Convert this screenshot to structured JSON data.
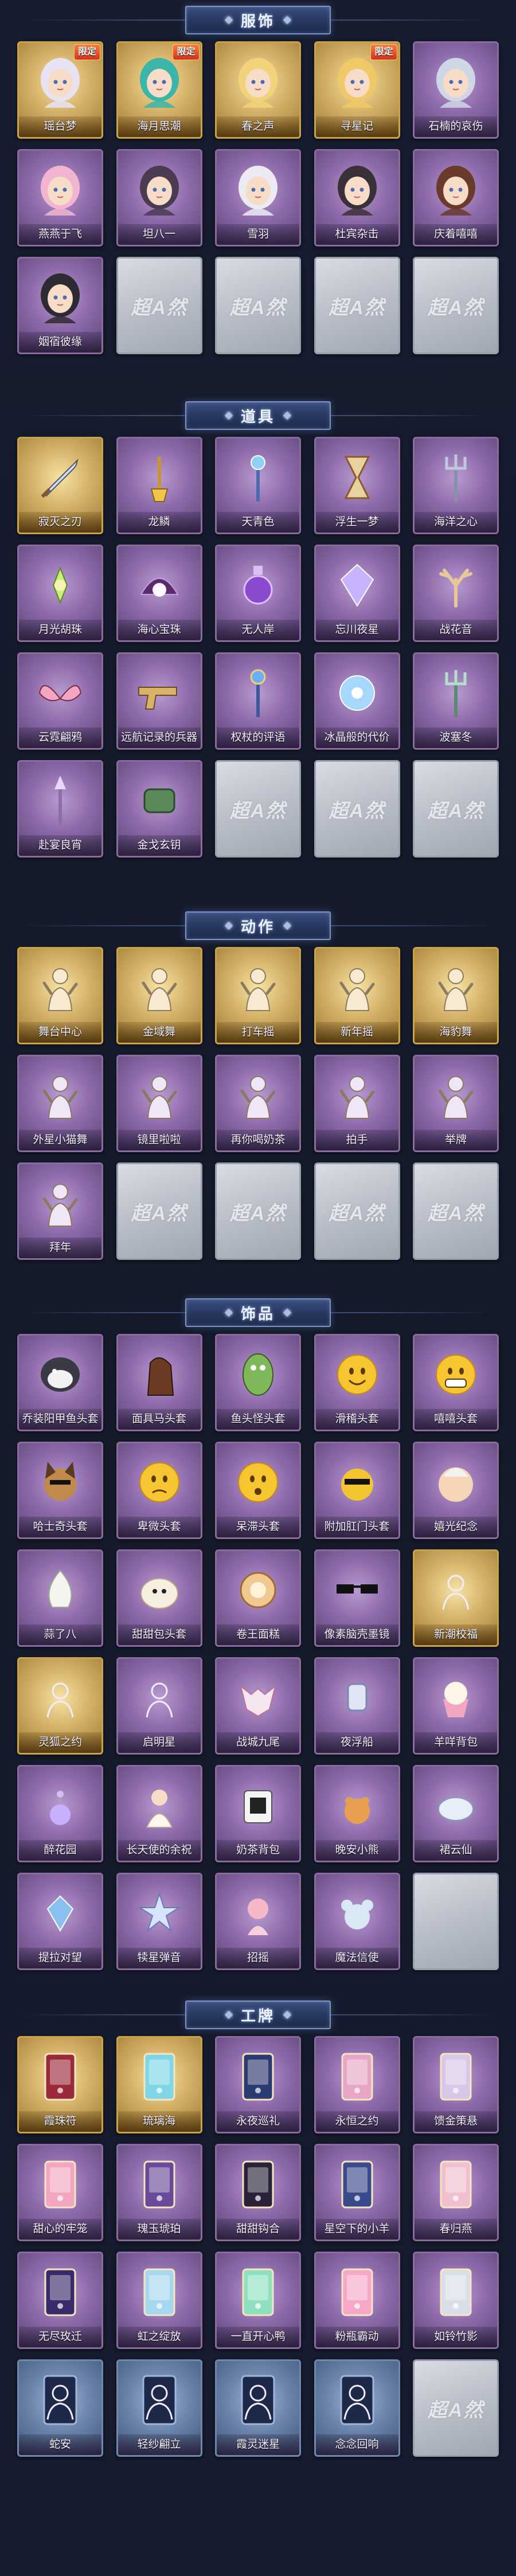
{
  "sections": [
    {
      "title": "服饰",
      "items": [
        {
          "label": "瑶台梦",
          "frame": "gold",
          "badge": "限定",
          "badge_style": "normal",
          "icon": "portrait-white-hair"
        },
        {
          "label": "海月思潮",
          "frame": "gold",
          "badge": "限定",
          "badge_style": "normal",
          "icon": "portrait-teal-hair"
        },
        {
          "label": "春之声",
          "frame": "gold",
          "badge": "",
          "badge_style": "",
          "icon": "portrait-golden"
        },
        {
          "label": "寻星记",
          "frame": "gold",
          "badge": "限定",
          "badge_style": "normal",
          "icon": "portrait-blonde"
        },
        {
          "label": "石楠的哀伤",
          "frame": "purple",
          "badge": "",
          "badge_style": "",
          "icon": "portrait-silver"
        },
        {
          "label": "燕燕于飞",
          "frame": "purple",
          "badge": "",
          "badge_style": "",
          "icon": "portrait-pink-hair"
        },
        {
          "label": "坦八一",
          "frame": "purple",
          "badge": "",
          "badge_style": "",
          "icon": "portrait-dark-hair"
        },
        {
          "label": "雪羽",
          "frame": "purple",
          "badge": "",
          "badge_style": "",
          "icon": "portrait-white-knight"
        },
        {
          "label": "杜宾杂击",
          "frame": "purple",
          "badge": "",
          "badge_style": "",
          "icon": "portrait-cat-ears"
        },
        {
          "label": "庆着嘻嘻",
          "frame": "purple",
          "badge": "",
          "badge_style": "",
          "icon": "portrait-chef"
        },
        {
          "label": "姻宿彼缘",
          "frame": "purple",
          "badge": "",
          "badge_style": "",
          "icon": "portrait-robe"
        },
        {
          "label": "",
          "frame": "gray",
          "badge": "",
          "badge_style": "",
          "icon": "",
          "watermark": "超A然"
        },
        {
          "label": "",
          "frame": "gray",
          "badge": "",
          "badge_style": "",
          "icon": "",
          "watermark": "超A然"
        },
        {
          "label": "",
          "frame": "gray",
          "badge": "",
          "badge_style": "",
          "icon": "",
          "watermark": "超A然"
        },
        {
          "label": "",
          "frame": "gray",
          "badge": "",
          "badge_style": "",
          "icon": "",
          "watermark": "超A然"
        }
      ]
    },
    {
      "title": "道具",
      "items": [
        {
          "label": "寂灭之刃",
          "frame": "gold",
          "icon": "sword-icon"
        },
        {
          "label": "龙鳞",
          "frame": "purple",
          "icon": "golden-shovel-icon"
        },
        {
          "label": "天青色",
          "frame": "purple",
          "icon": "blue-staff-icon"
        },
        {
          "label": "浮生一梦",
          "frame": "purple",
          "icon": "hourglass-icon"
        },
        {
          "label": "海洋之心",
          "frame": "purple",
          "icon": "trident-icon"
        },
        {
          "label": "月光胡珠",
          "frame": "purple",
          "icon": "green-lotus-icon"
        },
        {
          "label": "海心宝珠",
          "frame": "purple",
          "icon": "pearl-shell-icon"
        },
        {
          "label": "无人岸",
          "frame": "purple",
          "icon": "potion-icon"
        },
        {
          "label": "忘川夜星",
          "frame": "purple",
          "icon": "crystal-icon"
        },
        {
          "label": "战花音",
          "frame": "purple",
          "icon": "antler-icon"
        },
        {
          "label": "云霓翩鸦",
          "frame": "purple",
          "icon": "fan-wings-icon"
        },
        {
          "label": "远航记录的兵器",
          "frame": "purple",
          "icon": "pistol-icon"
        },
        {
          "label": "权杖的评语",
          "frame": "purple",
          "icon": "scepter-icon"
        },
        {
          "label": "冰晶般的代价",
          "frame": "purple",
          "icon": "ice-flower-icon"
        },
        {
          "label": "波塞冬",
          "frame": "purple",
          "icon": "trident-green-icon"
        },
        {
          "label": "赴宴良宵",
          "frame": "purple",
          "icon": "spear-icon"
        },
        {
          "label": "金戈玄钥",
          "frame": "purple",
          "icon": "green-device-icon"
        },
        {
          "label": "",
          "frame": "gray",
          "icon": "",
          "watermark": "超A然"
        },
        {
          "label": "",
          "frame": "gray",
          "icon": "",
          "watermark": "超A然"
        },
        {
          "label": "",
          "frame": "gray",
          "icon": "",
          "watermark": "超A然"
        }
      ]
    },
    {
      "title": "动作",
      "items": [
        {
          "label": "舞台中心",
          "frame": "gold",
          "icon": "pose-icon"
        },
        {
          "label": "金域舞",
          "frame": "gold",
          "icon": "pose-icon"
        },
        {
          "label": "打车摇",
          "frame": "gold",
          "icon": "pose-icon"
        },
        {
          "label": "新年摇",
          "frame": "gold",
          "icon": "pose-icon"
        },
        {
          "label": "海豹舞",
          "frame": "gold",
          "icon": "pose-icon"
        },
        {
          "label": "外星小猫舞",
          "frame": "purple",
          "icon": "pose-icon"
        },
        {
          "label": "镜里啦啦",
          "frame": "purple",
          "icon": "pose-icon"
        },
        {
          "label": "再你喝奶茶",
          "frame": "purple",
          "icon": "pose-icon"
        },
        {
          "label": "拍手",
          "frame": "purple",
          "icon": "pose-icon"
        },
        {
          "label": "举牌",
          "frame": "purple",
          "icon": "pose-icon"
        },
        {
          "label": "拜年",
          "frame": "purple",
          "icon": "pose-icon"
        },
        {
          "label": "",
          "frame": "gray",
          "icon": "",
          "watermark": "超A然"
        },
        {
          "label": "",
          "frame": "gray",
          "icon": "",
          "watermark": "超A然"
        },
        {
          "label": "",
          "frame": "gray",
          "icon": "",
          "watermark": "超A然"
        },
        {
          "label": "",
          "frame": "gray",
          "icon": "",
          "watermark": "超A然"
        }
      ]
    },
    {
      "title": "饰品",
      "items": [
        {
          "label": "乔装阳甲鱼头套",
          "frame": "purple",
          "icon": "penguin-head-icon"
        },
        {
          "label": "面具马头套",
          "frame": "purple",
          "icon": "horse-head-icon"
        },
        {
          "label": "鱼头怪头套",
          "frame": "purple",
          "icon": "fish-head-icon"
        },
        {
          "label": "滑稽头套",
          "frame": "purple",
          "icon": "smiley-icon"
        },
        {
          "label": "嘻嘻头套",
          "frame": "purple",
          "icon": "grin-icon"
        },
        {
          "label": "哈士奇头套",
          "frame": "purple",
          "icon": "dog-head-icon"
        },
        {
          "label": "卑微头套",
          "frame": "purple",
          "icon": "sad-smiley-icon"
        },
        {
          "label": "呆滞头套",
          "frame": "purple",
          "icon": "wow-smiley-icon"
        },
        {
          "label": "附加肛门头套",
          "frame": "purple",
          "icon": "cool-dog-icon"
        },
        {
          "label": "嬉光纪念",
          "frame": "purple",
          "icon": "baby-head-icon"
        },
        {
          "label": "蒜了八",
          "frame": "purple",
          "icon": "garlic-icon"
        },
        {
          "label": "甜甜包头套",
          "frame": "purple",
          "icon": "bun-icon"
        },
        {
          "label": "卷王面糕",
          "frame": "purple",
          "icon": "cake-roll-icon"
        },
        {
          "label": "像素脑壳墨镜",
          "frame": "purple",
          "icon": "pixel-glasses-icon"
        },
        {
          "label": "新潮校福",
          "frame": "gold",
          "icon": "bust-outline-icon"
        },
        {
          "label": "灵狐之约",
          "frame": "gold",
          "icon": "bust-outline-icon"
        },
        {
          "label": "启明星",
          "frame": "purple",
          "icon": "bust-outline-icon"
        },
        {
          "label": "战城九尾",
          "frame": "purple",
          "icon": "fox-mask-icon"
        },
        {
          "label": "夜浮船",
          "frame": "purple",
          "icon": "lantern-icon"
        },
        {
          "label": "羊咩背包",
          "frame": "purple",
          "icon": "cupcake-icon"
        },
        {
          "label": "醉花园",
          "frame": "purple",
          "icon": "flower-charm-icon"
        },
        {
          "label": "长天使的余祝",
          "frame": "purple",
          "icon": "angel-doll-icon"
        },
        {
          "label": "奶茶背包",
          "frame": "purple",
          "icon": "qr-bag-icon"
        },
        {
          "label": "晚安小熊",
          "frame": "purple",
          "icon": "bear-charm-icon"
        },
        {
          "label": "裙云仙",
          "frame": "purple",
          "icon": "cloud-charm-icon"
        },
        {
          "label": "提拉对望",
          "frame": "purple",
          "icon": "jewel-charm-icon"
        },
        {
          "label": "犊星弹音",
          "frame": "purple",
          "icon": "star-charm-icon"
        },
        {
          "label": "招摇",
          "frame": "purple",
          "icon": "girl-charm-icon"
        },
        {
          "label": "魔法信使",
          "frame": "purple",
          "icon": "mouse-charm-icon"
        },
        {
          "label": "",
          "frame": "gray",
          "icon": "",
          "watermark": ""
        }
      ]
    },
    {
      "title": "工牌",
      "items": [
        {
          "label": "霞珠符",
          "frame": "gold",
          "icon": "card-red-icon"
        },
        {
          "label": "琉璃海",
          "frame": "gold",
          "icon": "card-cyan-icon"
        },
        {
          "label": "永夜巡礼",
          "frame": "purple",
          "icon": "card-night-icon"
        },
        {
          "label": "永恒之约",
          "frame": "purple",
          "icon": "card-pink-icon"
        },
        {
          "label": "馈金策悬",
          "frame": "purple",
          "icon": "card-frame-icon"
        },
        {
          "label": "甜心的牢笼",
          "frame": "purple",
          "icon": "card-heart-icon"
        },
        {
          "label": "瑰玉琥珀",
          "frame": "purple",
          "icon": "card-violet-icon"
        },
        {
          "label": "甜甜钩合",
          "frame": "purple",
          "icon": "card-dark-icon"
        },
        {
          "label": "星空下的小羊",
          "frame": "purple",
          "icon": "card-starry-icon"
        },
        {
          "label": "春归燕",
          "frame": "purple",
          "icon": "card-rose-icon"
        },
        {
          "label": "无尽玫迁",
          "frame": "purple",
          "icon": "card-galaxy-icon"
        },
        {
          "label": "虹之绽放",
          "frame": "purple",
          "icon": "card-rainbow-icon"
        },
        {
          "label": "一直开心鸭",
          "frame": "purple",
          "icon": "card-duck-icon"
        },
        {
          "label": "粉瓶霸动",
          "frame": "purple",
          "icon": "card-bottle-icon"
        },
        {
          "label": "如铃竹影",
          "frame": "purple",
          "icon": "card-bamboo-icon"
        },
        {
          "label": "蛇安",
          "frame": "blue",
          "icon": "card-bust-icon"
        },
        {
          "label": "轻纱翩立",
          "frame": "blue",
          "icon": "card-bust-icon"
        },
        {
          "label": "霞灵迷星",
          "frame": "blue",
          "icon": "card-bust-icon"
        },
        {
          "label": "念念回响",
          "frame": "blue",
          "icon": "card-bust-icon"
        },
        {
          "label": "",
          "frame": "gray",
          "icon": "",
          "watermark": "超A然"
        }
      ]
    }
  ],
  "colors": {
    "gold": "#d4b067",
    "purple": "#8c6aa9",
    "gray": "#b9bec8",
    "blue": "#6b84ab"
  }
}
